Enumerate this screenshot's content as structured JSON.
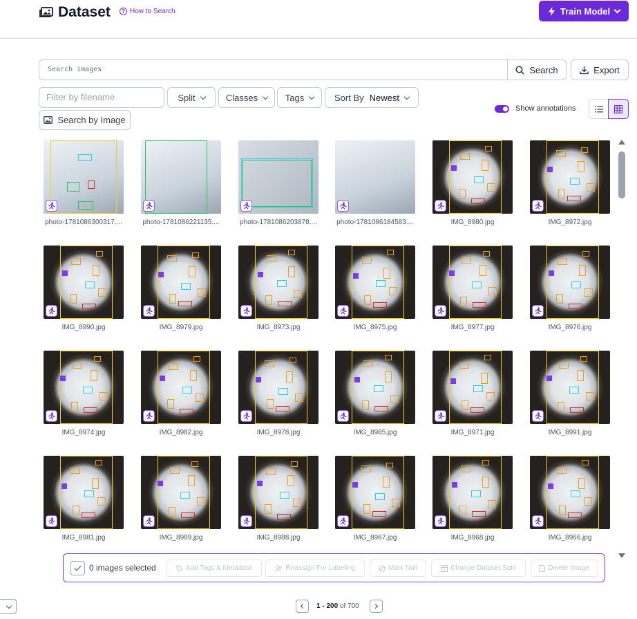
{
  "header": {
    "title": "Dataset",
    "title_icon": "image-gallery-icon",
    "help_link": "How to Search",
    "train_button": "Train Model"
  },
  "search": {
    "placeholder": "Search images",
    "search_button": "Search",
    "export_button": "Export"
  },
  "filters": {
    "filename_placeholder": "Filter by filename",
    "split": "Split",
    "classes": "Classes",
    "tags": "Tags",
    "sort_by_label": "Sort By",
    "sort_by_value": "Newest",
    "search_by_image": "Search by Image"
  },
  "view": {
    "show_annotations_label": "Show annotations",
    "show_annotations": true,
    "active_view": "grid"
  },
  "images": [
    [
      "photo-1781086300317....",
      "photo-1781086221135....",
      "photo-1781086203878....",
      "photo-1781086184583....",
      "IMG_8980.jpg",
      "IMG_8972.jpg"
    ],
    [
      "IMG_8990.jpg",
      "IMG_8979.jpg",
      "IMG_8973.jpg",
      "IMG_8975.jpg",
      "IMG_8977.jpg",
      "IMG_8976.jpg"
    ],
    [
      "IMG_8974.jpg",
      "IMG_8982.jpg",
      "IMG_8978.jpg",
      "IMG_8985.jpg",
      "IMG_8971.jpg",
      "IMG_8991.jpg"
    ],
    [
      "IMG_8981.jpg",
      "IMG_8989.jpg",
      "IMG_8988.jpg",
      "IMG_8967.jpg",
      "IMG_8968.jpg",
      "IMG_8966.jpg"
    ]
  ],
  "selection_bar": {
    "count_text": "0 images selected",
    "actions": [
      "Add Tags & Metadata",
      "Reassign For Labeling",
      "Mark Null",
      "Change Dataset Split",
      "Delete Image"
    ]
  },
  "pagination": {
    "range": "1 - 200",
    "of_text": "of 700"
  },
  "colors": {
    "accent": "#6d28d9",
    "annotation_orange": "#f59e0b",
    "annotation_cyan": "#22d3ee",
    "annotation_red": "#dc2626",
    "annotation_yellow": "#facc15"
  }
}
